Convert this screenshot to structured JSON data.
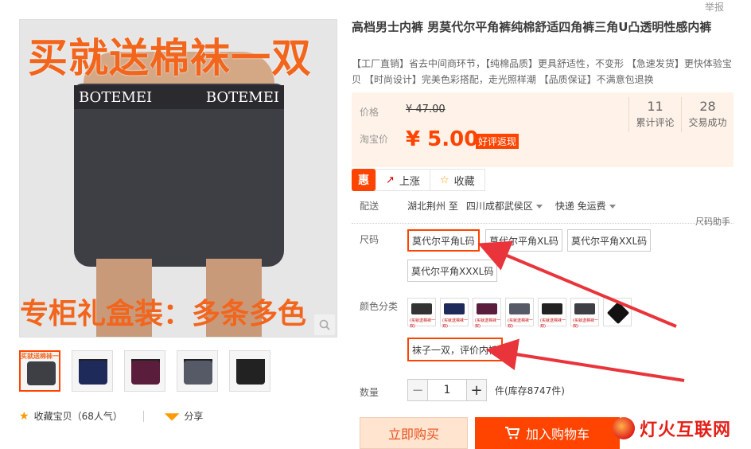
{
  "gallery": {
    "promo_top": "买就送棉袜一双",
    "promo_bottom": "专柜礼盒装：多条多色",
    "brand_left": "BOTEMEI",
    "brand_right": "BOTEMEI",
    "thumb_colors": [
      "#3e3f44",
      "#1e2a5a",
      "#5a1e3c",
      "#555a66",
      "#222222"
    ],
    "thumb_tiny": "买就送棉袜一双"
  },
  "collect": {
    "label": "收藏宝贝（68人气）",
    "share": "分享"
  },
  "report": "举报",
  "product": {
    "title": "高档男士内裤 男莫代尔平角裤纯棉舒适四角裤三角U凸透明性感内裤",
    "subtitle": "【工厂直销】省去中间商环节，【纯棉品质】更具舒适性，不变形 【急速发货】更快体验宝贝 【时尚设计】完美色彩搭配，走光照样潮 【品质保证】不满意包退换"
  },
  "price": {
    "label": "价格",
    "original": "¥ 47.00",
    "taobao_label": "淘宝价",
    "sale": "¥ 5.00",
    "badge": "好评返现",
    "reviews_num": "11",
    "reviews_label": "累计评论",
    "sold_num": "28",
    "sold_label": "交易成功"
  },
  "actions": {
    "hui": "惠",
    "rise": "上涨",
    "fav": "收藏"
  },
  "delivery": {
    "label": "配送",
    "from": "湖北荆州 至",
    "to": "四川成都武侯区",
    "express": "快递 免运费"
  },
  "size": {
    "helper": "尺码助手",
    "label": "尺码",
    "options": [
      "莫代尔平角L码",
      "莫代尔平角XL码",
      "莫代尔平角XXL码",
      "莫代尔平角XXXL码"
    ]
  },
  "color": {
    "label": "颜色分类",
    "swatch_caption": "(买就送棉袜一双)",
    "gift": "袜子一双，评价内裤"
  },
  "quantity": {
    "label": "数量",
    "value": "1",
    "minus": "−",
    "plus": "+",
    "stock": "件(库存8747件)"
  },
  "buttons": {
    "buy": "立即购买",
    "cart": "加入购物车"
  },
  "watermark": "灯火互联网",
  "colors": {
    "accent": "#ff4400",
    "price_bg": "#fff2e8",
    "arrow": "#e8343a"
  }
}
